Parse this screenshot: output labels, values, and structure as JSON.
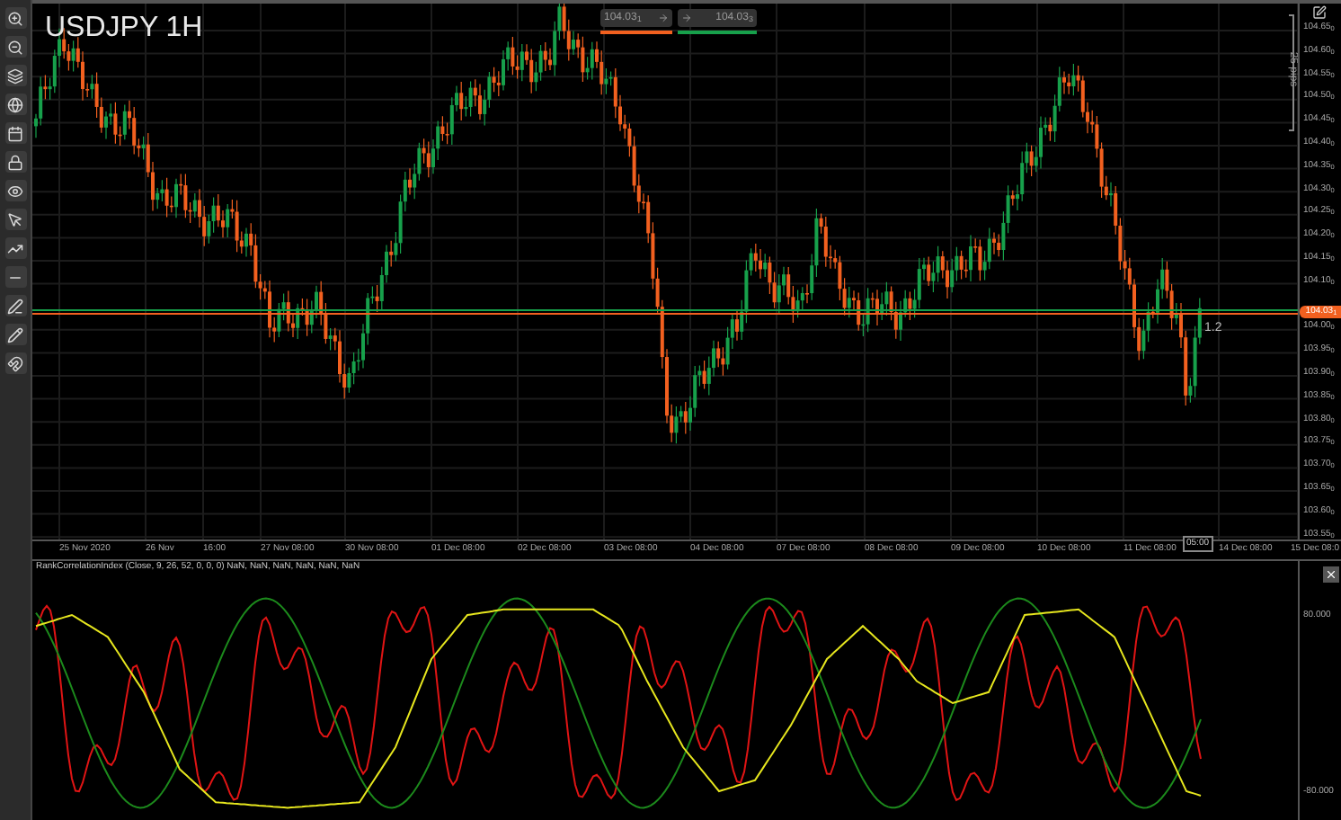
{
  "toolbar": [
    {
      "kind": "zoom-in"
    },
    {
      "kind": "zoom-out"
    },
    {
      "kind": "layers"
    },
    {
      "kind": "globe"
    },
    {
      "kind": "calendar"
    },
    {
      "kind": "lock"
    },
    {
      "kind": "eye"
    },
    {
      "kind": "cursor"
    },
    {
      "kind": "trend"
    },
    {
      "kind": "line"
    },
    {
      "kind": "pen"
    },
    {
      "kind": "pencil"
    },
    {
      "kind": "magnet"
    }
  ],
  "chart": {
    "title": "USDJPY 1H",
    "sell_price": "104.03$_{1}$",
    "buy_price": "104.03$_{3}$",
    "pip_range": "25 pips",
    "last_price": "104.03$_{1}$",
    "ratio_label": "1.2",
    "price_ticks": [
      "104.65$_{0}$",
      "104.60$_{0}$",
      "104.55$_{0}$",
      "104.50$_{0}$",
      "104.45$_{0}$",
      "104.40$_{0}$",
      "104.35$_{0}$",
      "104.30$_{0}$",
      "104.25$_{0}$",
      "104.20$_{0}$",
      "104.15$_{0}$",
      "104.10$_{0}$",
      "104.00$_{0}$",
      "103.95$_{0}$",
      "103.90$_{0}$",
      "103.85$_{0}$",
      "103.80$_{0}$",
      "103.75$_{0}$",
      "103.70$_{0}$",
      "103.65$_{0}$",
      "103.60$_{0}$",
      "103.55$_{0}$"
    ],
    "time_ticks": [
      "25 Nov 2020",
      "26 Nov",
      "16:00",
      "27 Nov 08:00",
      "30 Nov 08:00",
      "01 Dec 08:00",
      "02 Dec 08:00",
      "03 Dec 08:00",
      "04 Dec 08:00",
      "07 Dec 08:00",
      "08 Dec 08:00",
      "09 Dec 08:00",
      "10 Dec 08:00",
      "11 Dec 08:00",
      "14 Dec 08:00",
      "15 Dec 08:0"
    ],
    "crosshair_time": "05:00"
  },
  "indicator": {
    "legend": "RankCorrelationIndex (Close, 9, 26, 52, 0, 0, 0) NaN, NaN, NaN, NaN, NaN, NaN",
    "ticks": [
      "80.000",
      "-80.000"
    ]
  }
}
